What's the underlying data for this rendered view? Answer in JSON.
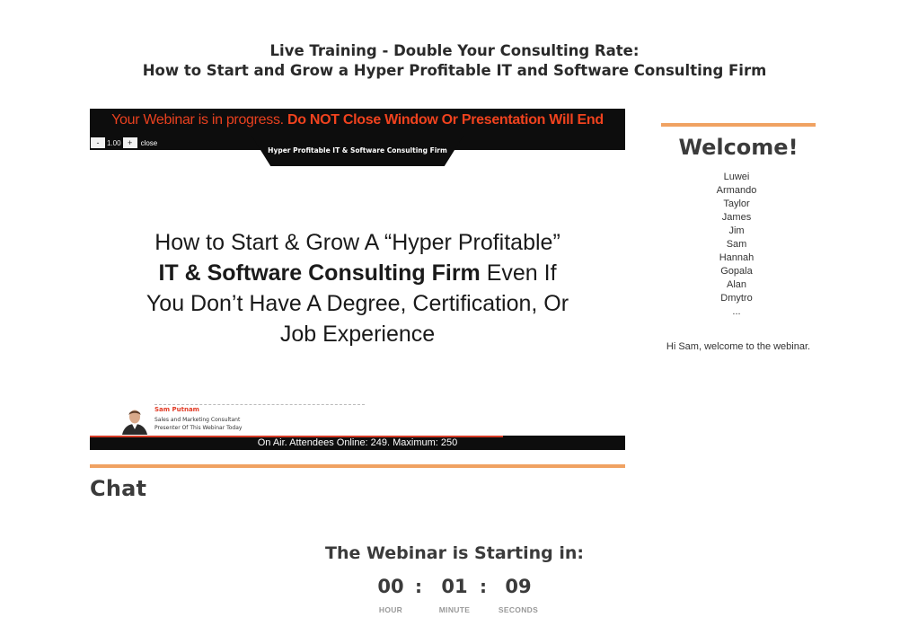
{
  "page": {
    "title_line1": "Live Training - Double Your Consulting Rate:",
    "title_line2": "How to Start and Grow a Hyper Profitable IT and Software Consulting Firm"
  },
  "video": {
    "banner_part1": "Your Webinar is in progress. ",
    "banner_part2": "Do NOT Close Window Or Presentation Will End",
    "subtitle": "Hyper Profitable IT & Software Consulting Firm",
    "zoom": {
      "minus_label": "-",
      "value": "1.00",
      "plus_label": "+",
      "close_label": "close"
    },
    "slide": {
      "line1": "How to Start & Grow A “Hyper Profitable”",
      "line2_strong": "IT & Software Consulting Firm",
      "line2_rest": " Even If",
      "line3": "You Don’t Have A Degree, Certification, Or",
      "line4": "Job Experience"
    },
    "presenter": {
      "name": "Sam Putnam",
      "role1": "Sales and Marketing Consultant",
      "role2": "Presenter Of This Webinar Today"
    },
    "status": "On Air. Attendees Online: 249. Maximum: 250"
  },
  "chat": {
    "heading": "Chat"
  },
  "sidebar": {
    "heading": "Welcome!",
    "attendees": [
      "Luwei",
      "Armando",
      "Taylor",
      "James",
      "Jim",
      "Sam",
      "Hannah",
      "Gopala",
      "Alan",
      "Dmytro",
      "..."
    ],
    "welcome_message": "Hi Sam, welcome to the webinar."
  },
  "countdown": {
    "title": "The Webinar is Starting in:",
    "hours": "00",
    "minutes": "01",
    "seconds": "09",
    "separator": ":",
    "hours_label": "HOUR",
    "minutes_label": "MINUTE",
    "seconds_label": "SECONDS"
  },
  "colors": {
    "accent_divider": "#f0a262",
    "banner_red": "#f0421e",
    "presenter_red": "#e23a24",
    "video_bar": "#0d0d0d"
  }
}
